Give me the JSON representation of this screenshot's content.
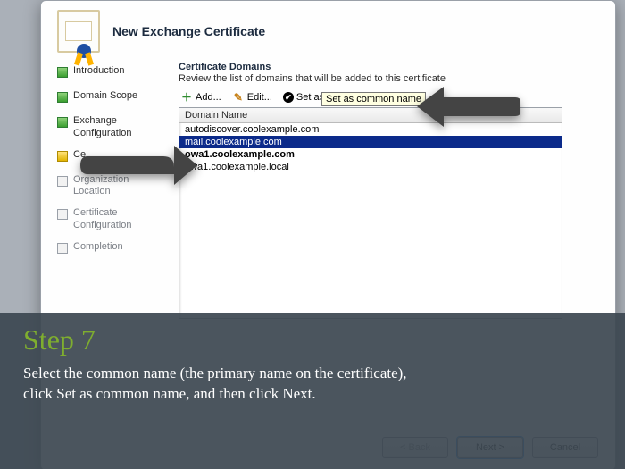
{
  "window": {
    "title": "New Exchange Certificate"
  },
  "steps": [
    {
      "label": "Introduction",
      "state": "done"
    },
    {
      "label": "Domain Scope",
      "state": "done"
    },
    {
      "label": "Exchange Configuration",
      "state": "done"
    },
    {
      "label": "Ce",
      "state": "current"
    },
    {
      "label": "Organization\nLocation",
      "state": "todo"
    },
    {
      "label": "Certificate Configuration",
      "state": "todo"
    },
    {
      "label": "Completion",
      "state": "todo"
    }
  ],
  "panel": {
    "title": "Certificate Domains",
    "subtitle": "Review the list of domains that will be added to this certificate",
    "column_header": "Domain Name"
  },
  "toolbar": {
    "add": {
      "label": "Add...",
      "icon": "plus-icon"
    },
    "edit": {
      "label": "Edit...",
      "icon": "edit-icon"
    },
    "common": {
      "label": "Set as common name",
      "icon": "check-icon",
      "tooltip": "Set as common name"
    },
    "remove": {
      "icon": "remove-icon"
    }
  },
  "domains": [
    {
      "name": "autodiscover.coolexample.com",
      "selected": false,
      "bold": false
    },
    {
      "name": "mail.coolexample.com",
      "selected": true,
      "bold": false
    },
    {
      "name": "owa1.coolexample.com",
      "selected": false,
      "bold": true
    },
    {
      "name": "owa1.coolexample.local",
      "selected": false,
      "bold": false
    }
  ],
  "buttons": {
    "back": "< Back",
    "next": "Next >",
    "cancel": "Cancel"
  },
  "overlay": {
    "step_label": "Step 7",
    "body": "Select the common name (the primary name on the certificate), click Set as common name, and then click Next."
  }
}
